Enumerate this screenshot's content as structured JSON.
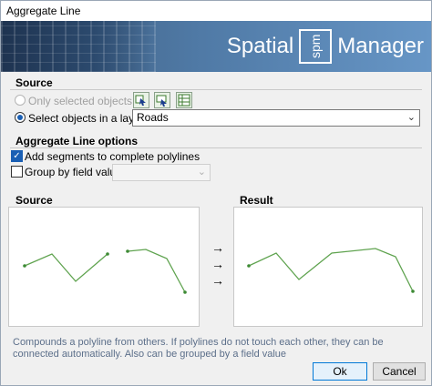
{
  "window": {
    "title": "Aggregate Line"
  },
  "banner": {
    "brand_left": "Spatial",
    "brand_box": "spm",
    "brand_right": "Manager"
  },
  "source": {
    "title": "Source",
    "only_selected_label": "Only selected objects",
    "select_in_layer_label": "Select objects in a layer",
    "layer_value": "Roads",
    "toolbar_icons": [
      "select-objects-icon",
      "select-add-icon",
      "select-table-icon"
    ]
  },
  "options": {
    "title": "Aggregate Line options",
    "add_segments_label": "Add segments to complete polylines",
    "add_segments_checked": true,
    "group_by_label": "Group by field value",
    "group_by_checked": false,
    "group_by_value": ""
  },
  "preview": {
    "source_title": "Source",
    "result_title": "Result",
    "arrows": [
      "→",
      "→",
      "→"
    ],
    "line_color": "#5fa34f"
  },
  "description": "Compounds a polyline from others. If polylines do not touch each other, they can be connected automatically. Also can be grouped by a field value",
  "buttons": {
    "ok": "Ok",
    "cancel": "Cancel"
  }
}
